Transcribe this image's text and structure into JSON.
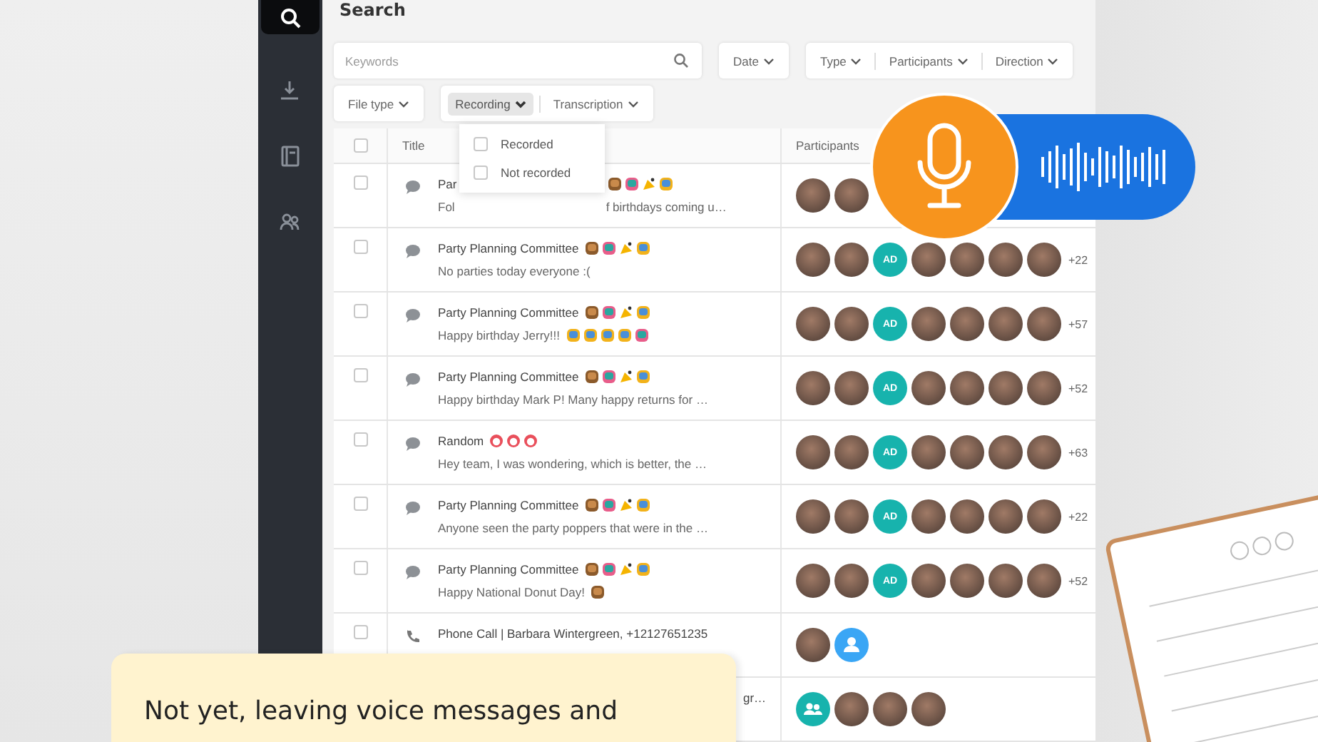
{
  "sidebar": {
    "items": [
      {
        "kind": "search",
        "selected": true
      },
      {
        "kind": "download",
        "selected": false
      },
      {
        "kind": "book",
        "selected": false
      },
      {
        "kind": "people",
        "selected": false
      }
    ]
  },
  "page_title": "Search",
  "keywords": {
    "placeholder": "Keywords"
  },
  "filter_rows": [
    [
      {
        "items": [
          {
            "label": "Date",
            "open": false
          }
        ]
      },
      {
        "items": [
          {
            "label": "Type",
            "open": false
          },
          {
            "label": "Participants",
            "open": false
          },
          {
            "label": "Direction",
            "open": false
          }
        ]
      }
    ],
    [
      {
        "items": [
          {
            "label": "File type",
            "open": false
          }
        ]
      },
      {
        "items": [
          {
            "label": "Recording",
            "open": true
          },
          {
            "label": "Transcription",
            "open": false
          }
        ]
      }
    ]
  ],
  "dropdown": {
    "options": [
      {
        "label": "Recorded",
        "checked": false
      },
      {
        "label": "Not recorded",
        "checked": false
      }
    ]
  },
  "table": {
    "select_all": {
      "checked": false
    },
    "columns": [
      "Title",
      "Participants"
    ],
    "rows": [
      {
        "kind": "chat",
        "checked": false,
        "title": "Par",
        "title_after_emojis": [
          {
            "kind": "donut"
          },
          {
            "kind": "cupcake"
          },
          {
            "kind": "popper"
          },
          {
            "kind": "cat"
          }
        ],
        "preview": "Fol",
        "preview_after": "f birthdays coming u…",
        "participants": [
          {
            "kind": "photo"
          },
          {
            "kind": "photo"
          }
        ]
      },
      {
        "kind": "chat",
        "checked": false,
        "title": "Party Planning Committee",
        "title_emojis": [
          {
            "kind": "donut"
          },
          {
            "kind": "cupcake"
          },
          {
            "kind": "popper"
          },
          {
            "kind": "cat"
          }
        ],
        "preview": "No parties today everyone :(",
        "participants": [
          {
            "kind": "photo"
          },
          {
            "kind": "photo"
          },
          {
            "kind": "initials",
            "text": "AD"
          },
          {
            "kind": "photo"
          },
          {
            "kind": "photo"
          },
          {
            "kind": "photo"
          },
          {
            "kind": "photo"
          }
        ],
        "more": "+22"
      },
      {
        "kind": "chat",
        "checked": false,
        "title": "Party Planning Committee",
        "title_emojis": [
          {
            "kind": "donut"
          },
          {
            "kind": "cupcake"
          },
          {
            "kind": "popper"
          },
          {
            "kind": "cat"
          }
        ],
        "preview": "Happy birthday Jerry!!!",
        "preview_emojis": [
          {
            "kind": "cat"
          },
          {
            "kind": "cat"
          },
          {
            "kind": "cat"
          },
          {
            "kind": "cat"
          },
          {
            "kind": "cupcake"
          }
        ],
        "participants": [
          {
            "kind": "photo"
          },
          {
            "kind": "photo"
          },
          {
            "kind": "initials",
            "text": "AD"
          },
          {
            "kind": "photo"
          },
          {
            "kind": "photo"
          },
          {
            "kind": "photo"
          },
          {
            "kind": "photo"
          }
        ],
        "more": "+57"
      },
      {
        "kind": "chat",
        "checked": false,
        "title": "Party Planning Committee",
        "title_emojis": [
          {
            "kind": "donut"
          },
          {
            "kind": "cupcake"
          },
          {
            "kind": "popper"
          },
          {
            "kind": "cat"
          }
        ],
        "preview": "Happy birthday Mark P! Many happy returns for …",
        "participants": [
          {
            "kind": "photo"
          },
          {
            "kind": "photo"
          },
          {
            "kind": "initials",
            "text": "AD"
          },
          {
            "kind": "photo"
          },
          {
            "kind": "photo"
          },
          {
            "kind": "photo"
          },
          {
            "kind": "photo"
          }
        ],
        "more": "+52"
      },
      {
        "kind": "chat",
        "checked": false,
        "title": "Random",
        "title_emojis": [
          {
            "kind": "face"
          },
          {
            "kind": "face"
          },
          {
            "kind": "face"
          }
        ],
        "preview": "Hey team, I was wondering, which is better, the …",
        "participants": [
          {
            "kind": "photo"
          },
          {
            "kind": "photo"
          },
          {
            "kind": "initials",
            "text": "AD"
          },
          {
            "kind": "photo"
          },
          {
            "kind": "photo"
          },
          {
            "kind": "photo"
          },
          {
            "kind": "photo"
          }
        ],
        "more": "+63"
      },
      {
        "kind": "chat",
        "checked": false,
        "title": "Party Planning Committee",
        "title_emojis": [
          {
            "kind": "donut"
          },
          {
            "kind": "cupcake"
          },
          {
            "kind": "popper"
          },
          {
            "kind": "cat"
          }
        ],
        "preview": "Anyone seen the party poppers that were in the …",
        "participants": [
          {
            "kind": "photo"
          },
          {
            "kind": "photo"
          },
          {
            "kind": "initials",
            "text": "AD"
          },
          {
            "kind": "photo"
          },
          {
            "kind": "photo"
          },
          {
            "kind": "photo"
          },
          {
            "kind": "photo"
          }
        ],
        "more": "+22"
      },
      {
        "kind": "chat",
        "checked": false,
        "title": "Party Planning Committee",
        "title_emojis": [
          {
            "kind": "donut"
          },
          {
            "kind": "cupcake"
          },
          {
            "kind": "popper"
          },
          {
            "kind": "cat"
          }
        ],
        "preview": "Happy National Donut Day!",
        "preview_emojis": [
          {
            "kind": "donut"
          }
        ],
        "participants": [
          {
            "kind": "photo"
          },
          {
            "kind": "photo"
          },
          {
            "kind": "initials",
            "text": "AD"
          },
          {
            "kind": "photo"
          },
          {
            "kind": "photo"
          },
          {
            "kind": "photo"
          },
          {
            "kind": "photo"
          }
        ],
        "more": "+52"
      },
      {
        "kind": "call",
        "checked": false,
        "title": "Phone Call | Barbara Wintergreen, +12127651235",
        "participants": [
          {
            "kind": "photo"
          },
          {
            "kind": "person"
          }
        ]
      },
      {
        "title_after": "gr…",
        "participants": [
          {
            "kind": "group"
          },
          {
            "kind": "photo"
          },
          {
            "kind": "photo"
          },
          {
            "kind": "photo"
          }
        ]
      }
    ]
  },
  "note": {
    "text": "Not yet, leaving voice messages and"
  }
}
